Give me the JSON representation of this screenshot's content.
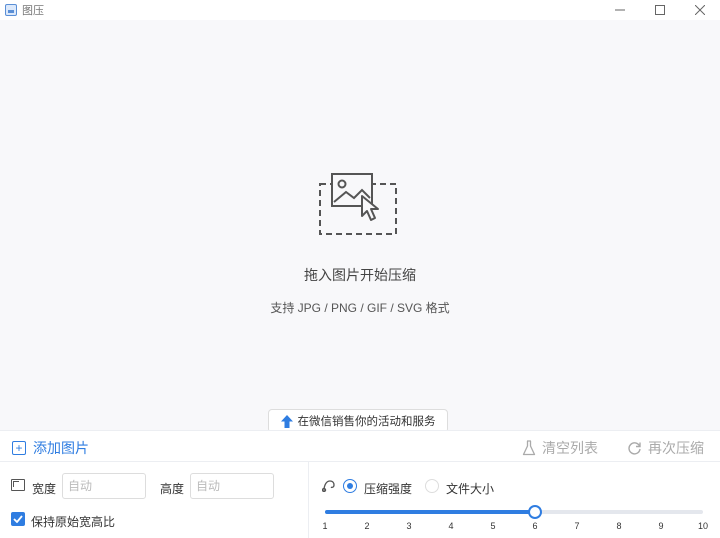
{
  "window": {
    "title": "图压",
    "controls": {
      "minimize": "–",
      "maximize": "☐",
      "close": "✕"
    }
  },
  "dropzone": {
    "icon": "image-drop-icon",
    "title": "拖入图片开始压缩",
    "subtitle": "支持 JPG / PNG / GIF / SVG 格式",
    "promo_label": "在微信销售你的活动和服务",
    "promo_icon": "upload-arrow-icon"
  },
  "toolbar": {
    "add_label": "添加图片",
    "clear_label": "清空列表",
    "recompress_label": "再次压缩"
  },
  "settings": {
    "width_label": "宽度",
    "width_placeholder": "自动",
    "height_label": "高度",
    "height_placeholder": "自动",
    "keep_ratio_label": "保持原始宽高比",
    "keep_ratio_checked": true,
    "mode_options": [
      {
        "label": "压缩强度",
        "selected": true
      },
      {
        "label": "文件大小",
        "selected": false
      }
    ],
    "strength": {
      "min": 1,
      "max": 10,
      "value": 6,
      "ticks": [
        "1",
        "2",
        "3",
        "4",
        "5",
        "6",
        "7",
        "8",
        "9",
        "10"
      ]
    }
  },
  "colors": {
    "accent": "#2f7de1",
    "muted": "#aaaaaa",
    "background": "#f8f8fa"
  }
}
